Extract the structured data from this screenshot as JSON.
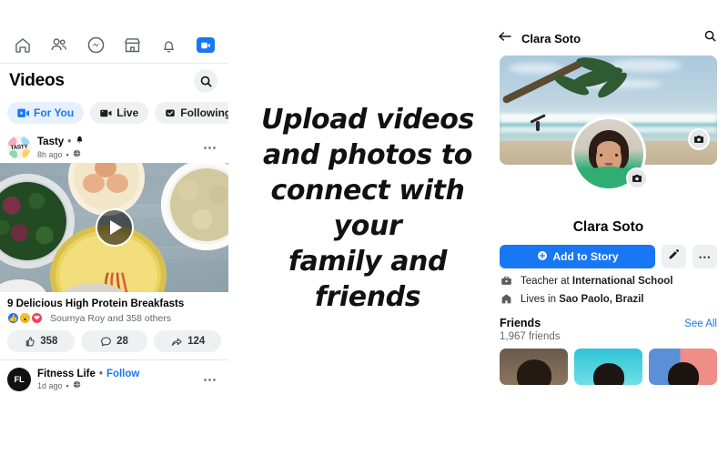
{
  "headline": {
    "lines": [
      "Upload videos",
      "and photos to",
      "connect with your",
      "family and",
      "friends"
    ]
  },
  "left_panel": {
    "nav_icons": [
      "home-icon",
      "friends-icon",
      "messenger-icon",
      "marketplace-icon",
      "notifications-icon",
      "watch-icon"
    ],
    "header_title": "Videos",
    "search_icon": "search-icon",
    "tabs": [
      {
        "label": "For You",
        "icon": "video-play-icon",
        "active": true
      },
      {
        "label": "Live",
        "icon": "live-camera-icon",
        "active": false
      },
      {
        "label": "Following",
        "icon": "check-bag-icon",
        "active": false
      }
    ],
    "post1": {
      "author": "Tasty",
      "separator": "•",
      "bell_icon": "bell-icon",
      "time": "8h ago",
      "privacy_icon": "globe-icon",
      "menu_icon": "kebab-menu-icon",
      "play_icon": "play-icon",
      "caption": "9 Delicious High Protein Breakfasts",
      "reactions_text": "Soumya Roy and 358 others",
      "reaction_icons": [
        "like-reaction",
        "wow-reaction",
        "love-reaction"
      ],
      "actions": [
        {
          "icon": "thumbs-up-icon",
          "count": "358"
        },
        {
          "icon": "comment-icon",
          "count": "28"
        },
        {
          "icon": "share-icon",
          "count": "124"
        }
      ]
    },
    "post2": {
      "avatar_initials": "FL",
      "author": "Fitness Life",
      "separator": "•",
      "follow_label": "Follow",
      "time": "1d ago",
      "privacy_icon": "globe-icon",
      "menu_icon": "kebab-menu-icon"
    }
  },
  "right_panel": {
    "back_icon": "back-arrow-icon",
    "title": "Clara Soto",
    "search_icon": "search-icon",
    "cover_camera_icon": "camera-icon",
    "avatar_camera_icon": "camera-icon",
    "profile_name": "Clara Soto",
    "add_to_story_label": "Add to Story",
    "add_to_story_icon": "plus-circle-icon",
    "edit_icon": "pencil-icon",
    "more_icon": "kebab-menu-icon",
    "bio": [
      {
        "icon": "briefcase-icon",
        "prefix": "Teacher at ",
        "bold": "International School"
      },
      {
        "icon": "home-building-icon",
        "prefix": "Lives in ",
        "bold": "Sao Paolo, Brazil"
      }
    ],
    "friends_title": "Friends",
    "see_all_label": "See All",
    "friends_count": "1,967 friends"
  },
  "colors": {
    "brand_blue": "#1877f2",
    "chip_gray": "#eef0f2",
    "text_primary": "#050505",
    "text_secondary": "#65676b"
  }
}
